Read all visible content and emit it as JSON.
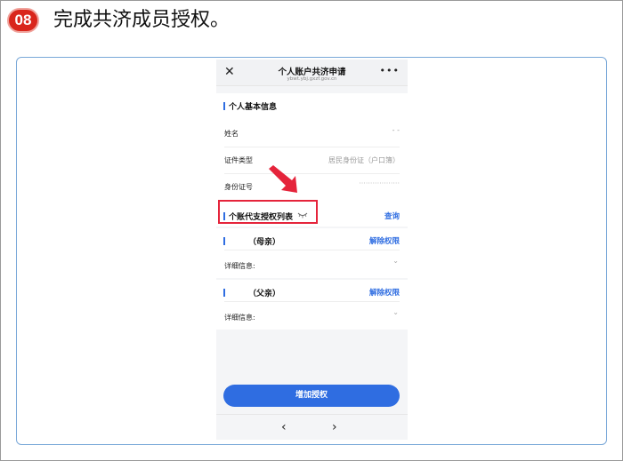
{
  "step": {
    "number": "08",
    "title": "完成共济成员授权。"
  },
  "mobile": {
    "title": "个人账户共济申请",
    "url": "ybwt.ybj.gxzf.gov.cn",
    "close_icon": "close-icon",
    "more_icon": "more-icon"
  },
  "basic_info": {
    "heading": "个人基本信息",
    "name_label": "姓名",
    "name_value": "- -",
    "id_type_label": "证件类型",
    "id_type_value": "居民身份证（户口簿）",
    "id_number_label": "身份证号",
    "id_number_value": "··················"
  },
  "auth_list": {
    "heading": "个账代支授权列表",
    "eye_icon": "eye-closed-icon",
    "query_label": "查询",
    "members": [
      {
        "relation": "（母亲）",
        "revoke_label": "解除权限",
        "detail_label": "详细信息:"
      },
      {
        "relation": "（父亲）",
        "revoke_label": "解除权限",
        "detail_label": "详细信息:"
      }
    ]
  },
  "add_button": "增加授权",
  "nav": {
    "back_icon": "chevron-left-icon",
    "forward_icon": "chevron-right-icon"
  },
  "colors": {
    "accent": "#2f6de1",
    "badge": "#d9261c",
    "highlight": "#e5243b",
    "panel_border": "#79a8d8"
  }
}
